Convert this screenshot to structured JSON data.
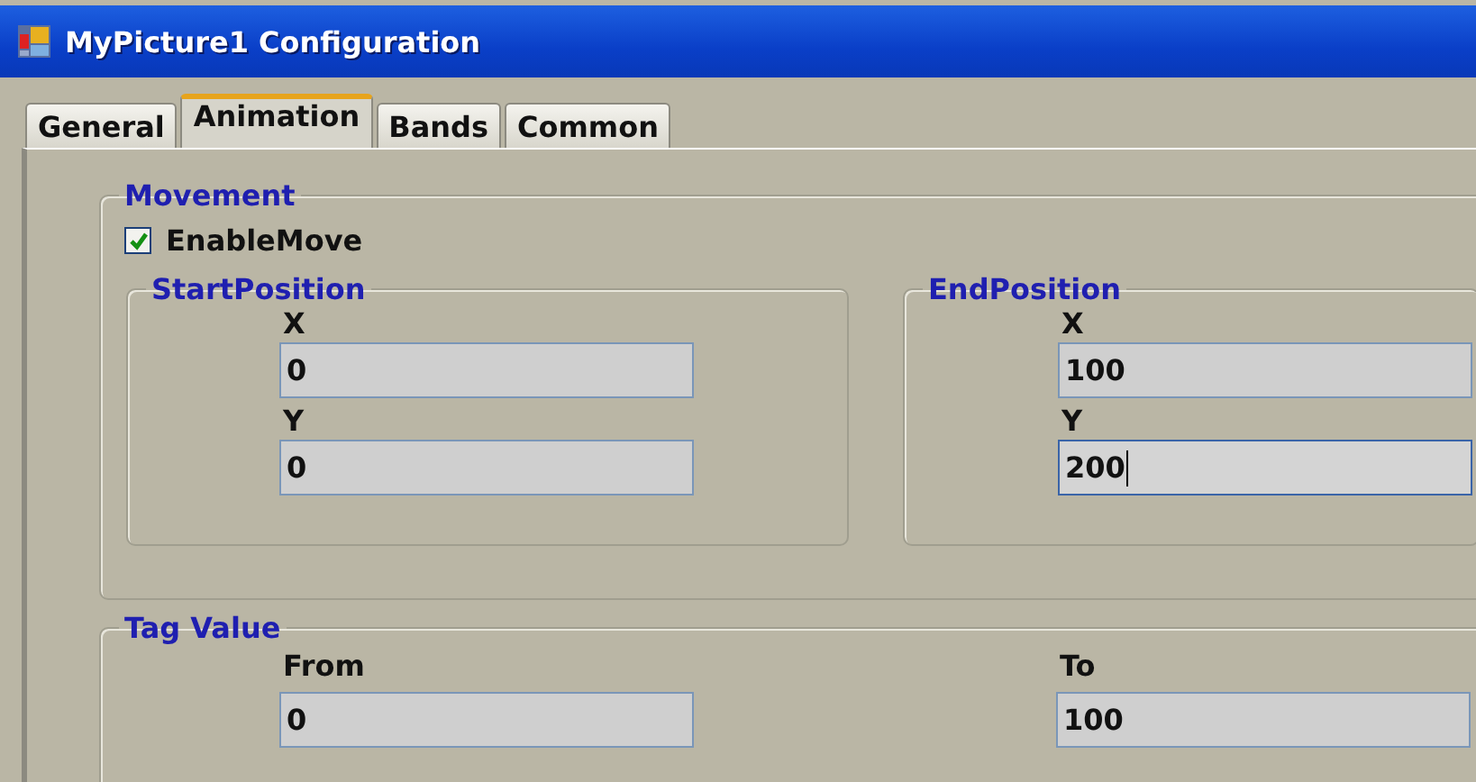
{
  "window": {
    "title": "MyPicture1 Configuration"
  },
  "tabs": [
    {
      "label": "General",
      "selected": false
    },
    {
      "label": "Animation",
      "selected": true
    },
    {
      "label": "Bands",
      "selected": false
    },
    {
      "label": "Common",
      "selected": false
    }
  ],
  "movement": {
    "title": "Movement",
    "enable_move": {
      "label": "EnableMove",
      "checked": true
    },
    "start_position": {
      "title": "StartPosition",
      "fields": [
        {
          "label": "X",
          "value": "0",
          "focused": false
        },
        {
          "label": "Y",
          "value": "0",
          "focused": false
        }
      ]
    },
    "end_position": {
      "title": "EndPosition",
      "fields": [
        {
          "label": "X",
          "value": "100",
          "focused": false
        },
        {
          "label": "Y",
          "value": "200",
          "focused": true
        }
      ]
    }
  },
  "tag_value": {
    "title": "Tag Value",
    "fields": [
      {
        "label": "From",
        "value": "0",
        "focused": false
      },
      {
        "label": "To",
        "value": "100",
        "focused": false
      }
    ]
  }
}
